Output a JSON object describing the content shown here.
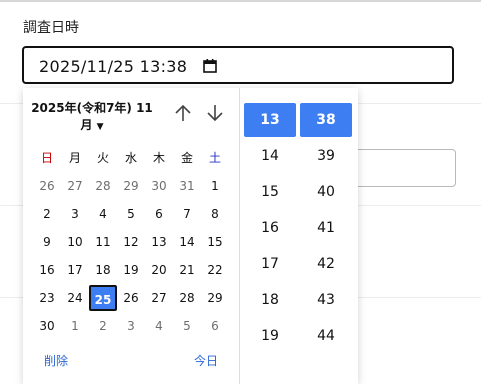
{
  "form": {
    "label": "調査日時",
    "value": "2025/11/25 13:38"
  },
  "picker": {
    "month_line1": "2025年(令和7年) 11",
    "month_line2": "月",
    "weekdays": [
      "日",
      "月",
      "火",
      "水",
      "木",
      "金",
      "土"
    ],
    "weeks": [
      [
        "26",
        "27",
        "28",
        "29",
        "30",
        "31",
        "1"
      ],
      [
        "2",
        "3",
        "4",
        "5",
        "6",
        "7",
        "8"
      ],
      [
        "9",
        "10",
        "11",
        "12",
        "13",
        "14",
        "15"
      ],
      [
        "16",
        "17",
        "18",
        "19",
        "20",
        "21",
        "22"
      ],
      [
        "23",
        "24",
        "25",
        "26",
        "27",
        "28",
        "29"
      ],
      [
        "30",
        "1",
        "2",
        "3",
        "4",
        "5",
        "6"
      ]
    ],
    "selected_day": "25",
    "clear_label": "削除",
    "today_label": "今日",
    "hours": [
      "13",
      "14",
      "15",
      "16",
      "17",
      "18",
      "19"
    ],
    "minutes": [
      "38",
      "39",
      "40",
      "41",
      "42",
      "43",
      "44"
    ],
    "selected_hour": "13",
    "selected_minute": "38"
  },
  "colors": {
    "accent": "#3d7ff3",
    "sunday": "#c00000",
    "saturday": "#2430c8",
    "link": "#2a67d2"
  }
}
